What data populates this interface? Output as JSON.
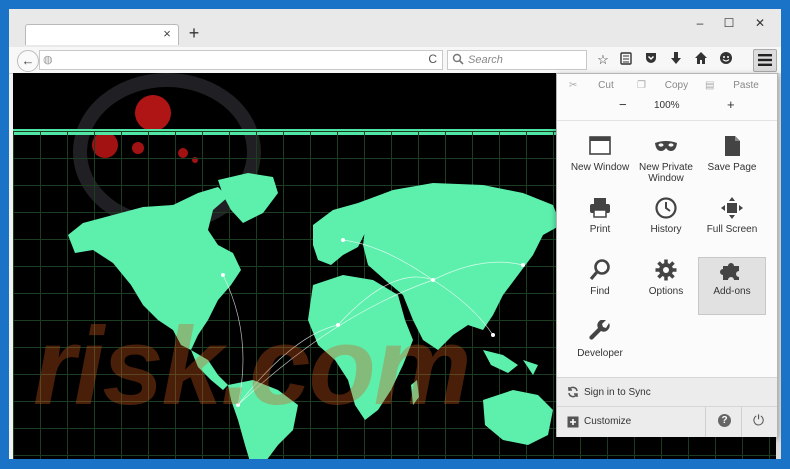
{
  "window": {
    "minimize": "–",
    "maximize": "☐",
    "close": "✕"
  },
  "tab": {
    "title": "",
    "close": "×"
  },
  "newtab": "+",
  "nav": {
    "back": "←",
    "url": "",
    "reload": "C",
    "search_placeholder": "Search"
  },
  "menu": {
    "edit": {
      "cut": "Cut",
      "copy": "Copy",
      "paste": "Paste"
    },
    "zoom": {
      "minus": "−",
      "level": "100%",
      "plus": "+"
    },
    "items": [
      {
        "label": "New Window",
        "icon": "new-window-icon"
      },
      {
        "label": "New Private Window",
        "icon": "private-mask-icon"
      },
      {
        "label": "Save Page",
        "icon": "save-page-icon"
      },
      {
        "label": "Print",
        "icon": "printer-icon"
      },
      {
        "label": "History",
        "icon": "clock-icon"
      },
      {
        "label": "Full Screen",
        "icon": "fullscreen-icon"
      },
      {
        "label": "Find",
        "icon": "magnifier-icon"
      },
      {
        "label": "Options",
        "icon": "gear-icon"
      },
      {
        "label": "Add-ons",
        "icon": "puzzle-icon"
      },
      {
        "label": "Developer",
        "icon": "wrench-icon"
      }
    ],
    "sync": "Sign in to Sync",
    "customize": "Customize",
    "help": "?",
    "quit": "⏻"
  },
  "page": {
    "watermark": "risk.com",
    "accent": "#4fe6a6",
    "grid_color": "#1d3d21"
  }
}
